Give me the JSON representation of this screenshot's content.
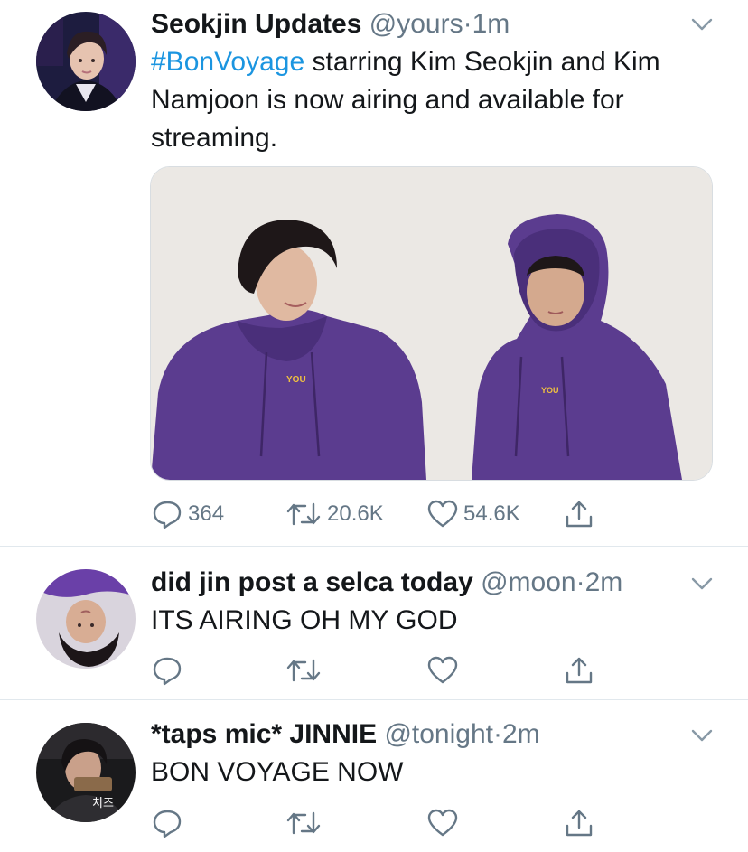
{
  "tweets": [
    {
      "name": "Seokjin Updates",
      "handle": "@yours",
      "separator": "·",
      "time": "1m",
      "hashtag": "#BonVoyage",
      "text": " starring Kim Seokjin and Kim Namjoon is now airing and available for streaming.",
      "has_media": true,
      "actions": {
        "replies": "364",
        "retweets": "20.6K",
        "likes": "54.6K"
      }
    },
    {
      "name": "did jin post a selca today",
      "handle": "@moon",
      "separator": "·",
      "time": "2m",
      "text": "ITS AIRING OH MY GOD",
      "actions": {
        "replies": "",
        "retweets": "",
        "likes": ""
      }
    },
    {
      "name": "*taps mic* JINNIE",
      "handle": "@tonight",
      "separator": "·",
      "time": "2m",
      "text": "BON VOYAGE NOW",
      "avatar_caption": "치즈",
      "actions": {
        "replies": "",
        "retweets": "",
        "likes": ""
      }
    }
  ],
  "icons": {
    "reply": "reply-icon",
    "retweet": "retweet-icon",
    "like": "heart-icon",
    "share": "share-icon",
    "more": "chevron-down-icon"
  },
  "colors": {
    "text": "#14171a",
    "secondary": "#657786",
    "link": "#1b95e0",
    "divider": "#e1e8ed",
    "hoodie": "#5b3c8f"
  }
}
